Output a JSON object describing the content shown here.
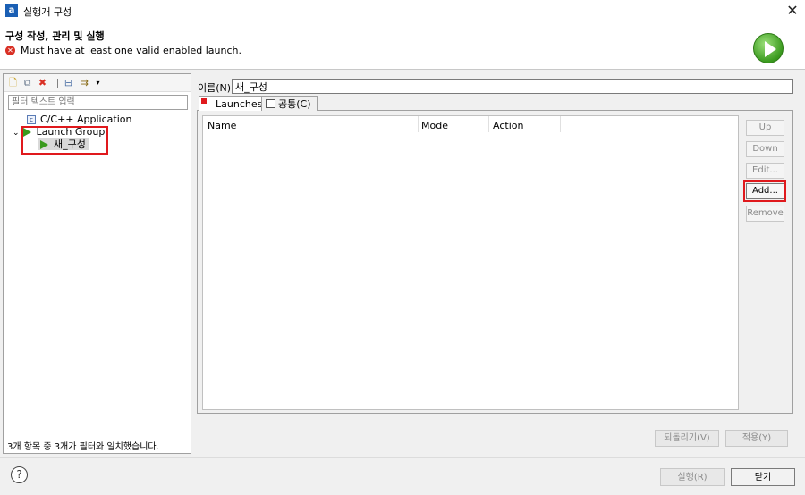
{
  "window": {
    "app_icon_letter": "a",
    "title": "실행개 구성",
    "close_glyph": "✕"
  },
  "header": {
    "title": "구성 작성, 관리 및 실행",
    "error_message": "Must have at least one valid enabled launch.",
    "error_icon": "error-icon",
    "run_icon": "run-icon"
  },
  "left_toolbar": {
    "icons": [
      "new-config-icon",
      "duplicate-icon",
      "delete-icon",
      "collapse-all-icon",
      "filter-icon",
      "dropdown-icon"
    ]
  },
  "filter": {
    "placeholder": "필터 텍스트 입력"
  },
  "tree": {
    "items": [
      {
        "label": "C/C++ Application",
        "icon": "c-app-icon"
      },
      {
        "label": "Launch Group",
        "icon": "launch-group-icon",
        "expanded": true
      },
      {
        "label": "새_구성",
        "icon": "play-icon",
        "selected": true
      }
    ],
    "status": "3개 항목 중 3개가 필터와 일치했습니다."
  },
  "name": {
    "label": "이름(N):",
    "value": "새_구성"
  },
  "tabs": [
    {
      "label": "Launches",
      "active": true
    },
    {
      "label": "공통(C)",
      "active": false
    }
  ],
  "table": {
    "columns": [
      "Name",
      "Mode",
      "Action"
    ],
    "rows": []
  },
  "side_buttons": {
    "up": "Up",
    "down": "Down",
    "edit": "Edit...",
    "add": "Add...",
    "remove": "Remove"
  },
  "footer": {
    "revert": "되돌리기(V)",
    "apply": "적용(Y)",
    "run": "실행(R)",
    "close": "닫기",
    "help": "?"
  },
  "colors": {
    "highlight_box": "#e0191d",
    "run_green": "#3a9a1e"
  }
}
